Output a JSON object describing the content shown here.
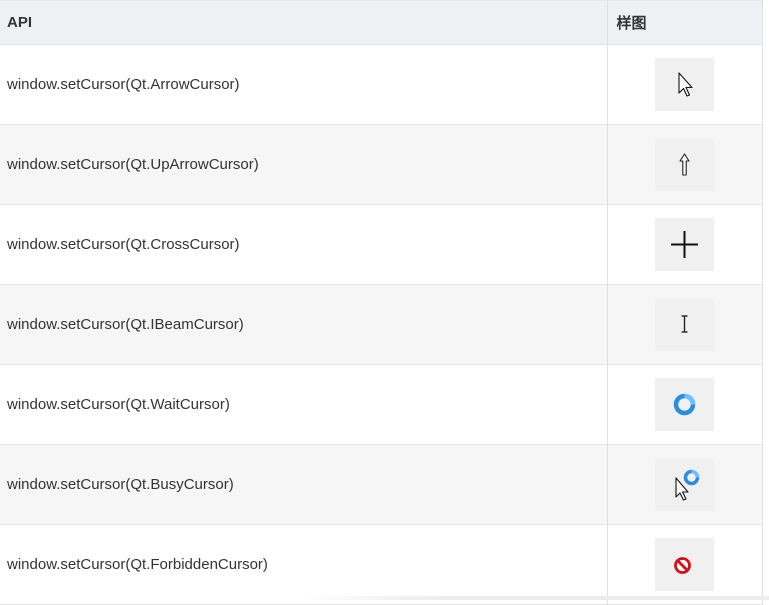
{
  "table": {
    "header": {
      "api": "API",
      "sample": "样图"
    },
    "rows": [
      {
        "api": "window.setCursor(Qt.ArrowCursor)",
        "icon": "arrow-cursor-icon"
      },
      {
        "api": "window.setCursor(Qt.UpArrowCursor)",
        "icon": "up-arrow-cursor-icon"
      },
      {
        "api": "window.setCursor(Qt.CrossCursor)",
        "icon": "cross-cursor-icon"
      },
      {
        "api": "window.setCursor(Qt.IBeamCursor)",
        "icon": "ibeam-cursor-icon"
      },
      {
        "api": "window.setCursor(Qt.WaitCursor)",
        "icon": "wait-cursor-icon"
      },
      {
        "api": "window.setCursor(Qt.BusyCursor)",
        "icon": "busy-cursor-icon"
      },
      {
        "api": "window.setCursor(Qt.ForbiddenCursor)",
        "icon": "forbidden-cursor-icon"
      }
    ]
  },
  "colors": {
    "header_bg": "#eef1f4",
    "row_alt_bg": "#f6f6f6",
    "sample_bg": "#f0f0f0",
    "wait_blue": "#2b8de0",
    "forbidden_red": "#d0121b"
  }
}
